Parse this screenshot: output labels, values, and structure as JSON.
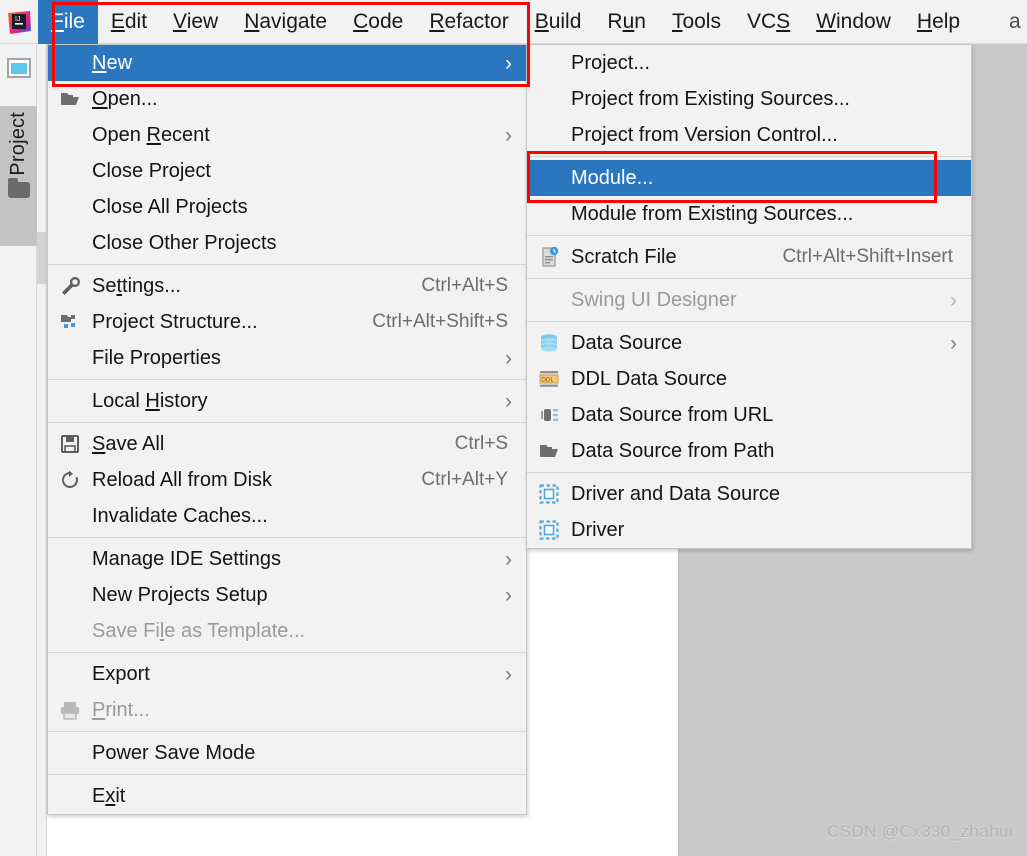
{
  "app": {
    "name": "IntelliJ IDEA",
    "logo_icon": "intellij-idea-logo"
  },
  "menubar": {
    "items": [
      {
        "label": "File",
        "mnemonic": "F",
        "selected": true
      },
      {
        "label": "Edit",
        "mnemonic": "E",
        "selected": false
      },
      {
        "label": "View",
        "mnemonic": "V",
        "selected": false
      },
      {
        "label": "Navigate",
        "mnemonic": "N",
        "selected": false
      },
      {
        "label": "Code",
        "mnemonic": "C",
        "selected": false
      },
      {
        "label": "Refactor",
        "mnemonic": "R",
        "selected": false
      },
      {
        "label": "Build",
        "mnemonic": "B",
        "selected": false
      },
      {
        "label": "Run",
        "mnemonic": "u",
        "selected": false
      },
      {
        "label": "Tools",
        "mnemonic": "T",
        "selected": false
      },
      {
        "label": "VCS",
        "mnemonic": "S",
        "selected": false
      },
      {
        "label": "Window",
        "mnemonic": "W",
        "selected": false
      },
      {
        "label": "Help",
        "mnemonic": "H",
        "selected": false
      }
    ],
    "tail_text": "a"
  },
  "left_toolbar": {
    "window_icon": "tool-window-icon",
    "project_tab": {
      "label": "Project",
      "icon": "folder-icon",
      "active": true
    }
  },
  "file_menu": {
    "items": [
      {
        "label": "New",
        "mnemonic": "N",
        "icon": null,
        "accel": "",
        "arrow": true,
        "highlight": true,
        "disabled": false
      },
      {
        "separator": false
      },
      {
        "label": "Open...",
        "mnemonic": "O",
        "icon": "open-folder-icon",
        "accel": "",
        "arrow": false,
        "highlight": false,
        "disabled": false
      },
      {
        "label": "Open Recent",
        "mnemonic": "R",
        "icon": null,
        "accel": "",
        "arrow": true,
        "highlight": false,
        "disabled": false
      },
      {
        "label": "Close Project",
        "mnemonic": "",
        "icon": null,
        "accel": "",
        "arrow": false,
        "highlight": false,
        "disabled": false
      },
      {
        "label": "Close All Projects",
        "mnemonic": "",
        "icon": null,
        "accel": "",
        "arrow": false,
        "highlight": false,
        "disabled": false
      },
      {
        "label": "Close Other Projects",
        "mnemonic": "",
        "icon": null,
        "accel": "",
        "arrow": false,
        "highlight": false,
        "disabled": false
      },
      {
        "separator": true
      },
      {
        "label": "Settings...",
        "mnemonic": "t",
        "icon": "wrench-icon",
        "accel": "Ctrl+Alt+S",
        "arrow": false,
        "highlight": false,
        "disabled": false
      },
      {
        "label": "Project Structure...",
        "mnemonic": "",
        "icon": "project-structure-icon",
        "accel": "Ctrl+Alt+Shift+S",
        "arrow": false,
        "highlight": false,
        "disabled": false
      },
      {
        "label": "File Properties",
        "mnemonic": "",
        "icon": null,
        "accel": "",
        "arrow": true,
        "highlight": false,
        "disabled": false
      },
      {
        "separator": true
      },
      {
        "label": "Local History",
        "mnemonic": "H",
        "icon": null,
        "accel": "",
        "arrow": true,
        "highlight": false,
        "disabled": false
      },
      {
        "separator": true
      },
      {
        "label": "Save All",
        "mnemonic": "S",
        "icon": "save-disk-icon",
        "accel": "Ctrl+S",
        "arrow": false,
        "highlight": false,
        "disabled": false
      },
      {
        "label": "Reload All from Disk",
        "mnemonic": "",
        "icon": "refresh-icon",
        "accel": "Ctrl+Alt+Y",
        "arrow": false,
        "highlight": false,
        "disabled": false
      },
      {
        "label": "Invalidate Caches...",
        "mnemonic": "",
        "icon": null,
        "accel": "",
        "arrow": false,
        "highlight": false,
        "disabled": false
      },
      {
        "separator": true
      },
      {
        "label": "Manage IDE Settings",
        "mnemonic": "",
        "icon": null,
        "accel": "",
        "arrow": true,
        "highlight": false,
        "disabled": false
      },
      {
        "label": "New Projects Setup",
        "mnemonic": "",
        "icon": null,
        "accel": "",
        "arrow": true,
        "highlight": false,
        "disabled": false
      },
      {
        "label": "Save File as Template...",
        "mnemonic": "l",
        "icon": null,
        "accel": "",
        "arrow": false,
        "highlight": false,
        "disabled": true
      },
      {
        "separator": true
      },
      {
        "label": "Export",
        "mnemonic": "",
        "icon": null,
        "accel": "",
        "arrow": true,
        "highlight": false,
        "disabled": false
      },
      {
        "label": "Print...",
        "mnemonic": "P",
        "icon": "printer-icon",
        "accel": "",
        "arrow": false,
        "highlight": false,
        "disabled": true
      },
      {
        "separator": true
      },
      {
        "label": "Power Save Mode",
        "mnemonic": "",
        "icon": null,
        "accel": "",
        "arrow": false,
        "highlight": false,
        "disabled": false
      },
      {
        "separator": true
      },
      {
        "label": "Exit",
        "mnemonic": "x",
        "icon": null,
        "accel": "",
        "arrow": false,
        "highlight": false,
        "disabled": false
      }
    ]
  },
  "new_submenu": {
    "items": [
      {
        "label": "Project...",
        "icon": null,
        "accel": "",
        "arrow": false,
        "highlight": false,
        "disabled": false
      },
      {
        "label": "Project from Existing Sources...",
        "icon": null,
        "accel": "",
        "arrow": false,
        "highlight": false,
        "disabled": false
      },
      {
        "label": "Project from Version Control...",
        "icon": null,
        "accel": "",
        "arrow": false,
        "highlight": false,
        "disabled": false
      },
      {
        "separator": true
      },
      {
        "label": "Module...",
        "icon": null,
        "accel": "",
        "arrow": false,
        "highlight": true,
        "disabled": false
      },
      {
        "label": "Module from Existing Sources...",
        "icon": null,
        "accel": "",
        "arrow": false,
        "highlight": false,
        "disabled": false
      },
      {
        "separator": true
      },
      {
        "label": "Scratch File",
        "icon": "scratch-file-icon",
        "accel": "Ctrl+Alt+Shift+Insert",
        "arrow": false,
        "highlight": false,
        "disabled": false
      },
      {
        "separator": true
      },
      {
        "label": "Swing UI Designer",
        "icon": null,
        "accel": "",
        "arrow": true,
        "highlight": false,
        "disabled": true
      },
      {
        "separator": true
      },
      {
        "label": "Data Source",
        "icon": "database-icon",
        "accel": "",
        "arrow": true,
        "highlight": false,
        "disabled": false
      },
      {
        "label": "DDL Data Source",
        "icon": "ddl-icon",
        "accel": "",
        "arrow": false,
        "highlight": false,
        "disabled": false
      },
      {
        "label": "Data Source from URL",
        "icon": "data-source-url-icon",
        "accel": "",
        "arrow": false,
        "highlight": false,
        "disabled": false
      },
      {
        "label": "Data Source from Path",
        "icon": "open-folder-icon",
        "accel": "",
        "arrow": false,
        "highlight": false,
        "disabled": false
      },
      {
        "separator": true
      },
      {
        "label": "Driver and Data Source",
        "icon": "driver-icon",
        "accel": "",
        "arrow": false,
        "highlight": false,
        "disabled": false
      },
      {
        "label": "Driver",
        "icon": "driver-icon",
        "accel": "",
        "arrow": false,
        "highlight": false,
        "disabled": false
      }
    ]
  },
  "annotations": {
    "color": "#ff0000",
    "boxes": [
      {
        "name": "file-new-highlight-box"
      },
      {
        "name": "module-highlight-box"
      }
    ]
  },
  "watermark": {
    "text": "CSDN @Cx330_zhahui"
  },
  "colors": {
    "selection_blue": "#2a77c0",
    "menu_bg": "#f2f2f2",
    "annotation_red": "#ff0000",
    "desktop_gray": "#c9c9c9",
    "editor_white": "#ffffff",
    "disabled_text": "#9a9a9a"
  }
}
